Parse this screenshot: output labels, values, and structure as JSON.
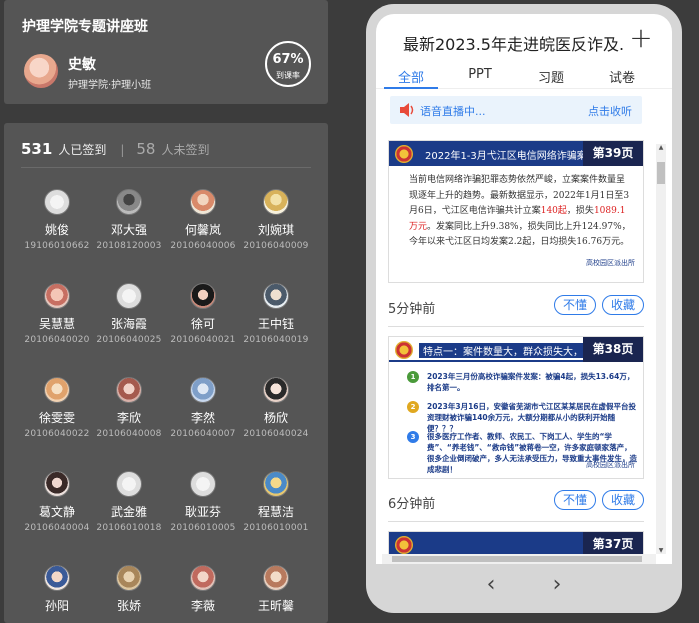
{
  "class": {
    "title": "护理学院专题讲座班",
    "user_name": "史敏",
    "user_sub": "护理学院·护理小班",
    "rate_value": "67%",
    "rate_label": "到课率"
  },
  "signin": {
    "signed_count": "531",
    "signed_label": "人已签到",
    "separator": "|",
    "unsigned_count": "58",
    "unsigned_label": "人未签到"
  },
  "students": [
    {
      "name": "姚俊",
      "id": "19106010662"
    },
    {
      "name": "邓大强",
      "id": "20108120003"
    },
    {
      "name": "何馨岚",
      "id": "20106040006"
    },
    {
      "name": "刘婉琪",
      "id": "20106040009"
    },
    {
      "name": "吴慧慧",
      "id": "20106040020"
    },
    {
      "name": "张海霞",
      "id": "20106040025"
    },
    {
      "name": "徐可",
      "id": "20106040021"
    },
    {
      "name": "王中钰",
      "id": "20106040019"
    },
    {
      "name": "徐雯雯",
      "id": "20106040022"
    },
    {
      "name": "李欣",
      "id": "20106040008"
    },
    {
      "name": "李然",
      "id": "20106040007"
    },
    {
      "name": "杨欣",
      "id": "20106040024"
    },
    {
      "name": "葛文静",
      "id": "20106040004"
    },
    {
      "name": "武金雅",
      "id": "20106010018"
    },
    {
      "name": "耿亚芬",
      "id": "20106010005"
    },
    {
      "name": "程慧洁",
      "id": "20106010001"
    },
    {
      "name": "孙阳",
      "id": ""
    },
    {
      "name": "张娇",
      "id": ""
    },
    {
      "name": "李薇",
      "id": ""
    },
    {
      "name": "王昕馨",
      "id": ""
    }
  ],
  "doc": {
    "title": "最新2023.5年走进皖医反诈及...",
    "tabs": [
      "全部",
      "PPT",
      "习题",
      "试卷"
    ],
    "live_text": "语音直播中...",
    "live_collect": "点击收听"
  },
  "slides": [
    {
      "head": "2022年1-3月弋江区电信网络诈骗案件呈高发",
      "page": "第39页",
      "body_1": "当前电信网络诈骗犯罪态势依然严峻，立案案件数量呈现逐年上升的趋势。最新数据显示，2022年1月1日至3月6日，弋江区电信诈骗共计立案",
      "body_red_1": "140起",
      "body_2": "，损失",
      "body_red_2": "1089.1万元",
      "body_3": "。发案同比上升9.38%，损失同比上升124.97%，今年以来弋江区日均发案2.2起，日均损失16.76万元。",
      "footer": "高校园区派出所",
      "time": "5分钟前",
      "btn_dont_understand": "不懂",
      "btn_collect": "收藏"
    },
    {
      "head": "特点一：案件数量大，群众损失大，社会危害",
      "page": "第38页",
      "item_1": "2023年三月份高校诈骗案件发案：被骗4起，损失13.64万，排名第一。",
      "item_2": "2023年3月16日，安徽省芜湖市弋江区某某居民在虚假平台投资理财被诈骗140余万元，大额分期都从小的获利开始随便？？？",
      "item_3": "很多医疗工作者、教师、农民工、下岗工人、学生的“学费”、“养老钱”、“救命钱”被蒋卷一空，许多家庭顿家落产，很多企业倒闭破产，多人无法承受压力，导致重大事件发生，造成悲剧！",
      "footer": "高校园区派出所",
      "time": "6分钟前",
      "btn_dont_understand": "不懂",
      "btn_collect": "收藏"
    },
    {
      "page": "第37页"
    }
  ],
  "colors": {
    "accent": "#2f7be8",
    "panel": "#555555",
    "background": "#3c3c3c",
    "slide_head": "#1b3b88"
  }
}
